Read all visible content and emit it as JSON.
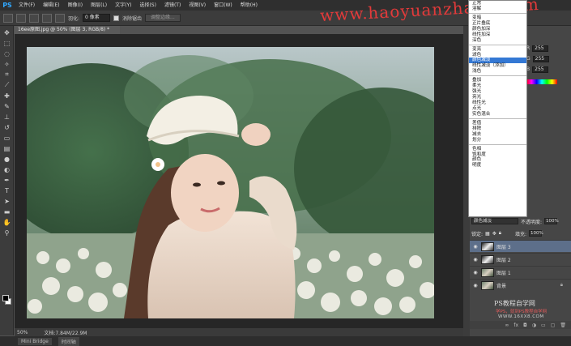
{
  "app": {
    "logo": "PS"
  },
  "menu": [
    "文件(F)",
    "编辑(E)",
    "图像(I)",
    "图层(L)",
    "文字(Y)",
    "选择(S)",
    "滤镜(T)",
    "视图(V)",
    "窗口(W)",
    "帮助(H)"
  ],
  "watermark": "www.haoyuanzhaoli.com",
  "options": {
    "feather_label": "羽化:",
    "feather_value": "0 像素",
    "antialias_label": "消除锯齿",
    "refine_button": "调整边缘..."
  },
  "document": {
    "tab_title": "16ee原图.jpg @ 50% (图层 3, RGB/8) *"
  },
  "status": {
    "zoom": "50%",
    "doc_size": "文档:7.84M/22.9M"
  },
  "bottom_tabs": [
    "Mini Bridge",
    "时间轴"
  ],
  "channels": [
    {
      "label": "R",
      "value": "255"
    },
    {
      "label": "G",
      "value": "255"
    },
    {
      "label": "B",
      "value": "255"
    }
  ],
  "blend_modes": {
    "groups": [
      [
        "正常",
        "溶解"
      ],
      [
        "变暗",
        "正片叠底",
        "颜色加深",
        "线性加深",
        "深色"
      ],
      [
        "变亮",
        "滤色",
        "颜色减淡",
        "线性减淡（添加）",
        "浅色"
      ],
      [
        "叠加",
        "柔光",
        "强光",
        "亮光",
        "线性光",
        "点光",
        "实色混合"
      ],
      [
        "差值",
        "排除",
        "减去",
        "划分"
      ],
      [
        "色相",
        "饱和度",
        "颜色",
        "明度"
      ]
    ],
    "selected": "颜色减淡"
  },
  "layers_panel": {
    "blend_value": "颜色减淡",
    "opacity_label": "不透明度:",
    "opacity_value": "100%",
    "lock_label": "锁定:",
    "fill_label": "填充:",
    "fill_value": "100%",
    "layers": [
      {
        "name": "图层 3",
        "active": true
      },
      {
        "name": "图层 2",
        "active": false
      },
      {
        "name": "图层 1",
        "active": false
      },
      {
        "name": "背景",
        "active": false
      }
    ]
  },
  "brand": {
    "line1": "PS教程自学网",
    "line2": "学PS，就到PS教程自学网",
    "line3": "WWW.16XX8.COM"
  }
}
